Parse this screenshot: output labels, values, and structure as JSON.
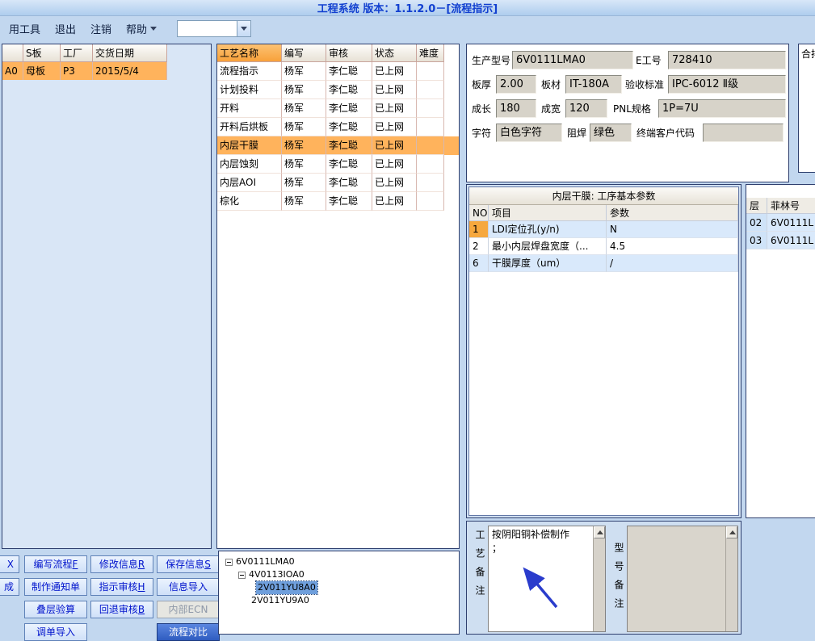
{
  "window": {
    "title": "工程系统 版本：1.1.2.0－[流程指示]"
  },
  "menubar": {
    "items": [
      {
        "label": "用工具"
      },
      {
        "label": "退出"
      },
      {
        "label": "注销"
      },
      {
        "label": "帮助"
      }
    ],
    "combo_value": ""
  },
  "board_panel": {
    "headers": {
      "cut": "",
      "sboard": "S板",
      "factory": "工厂",
      "delivery": "交货日期"
    },
    "row": {
      "cut": "A0",
      "sboard": "母板",
      "factory": "P3",
      "delivery": "2015/5/4"
    }
  },
  "process_panel": {
    "headers": {
      "name": "工艺名称",
      "writer": "编写",
      "auditor": "审核",
      "status": "状态",
      "difficulty": "难度"
    },
    "rows": [
      {
        "name": "流程指示",
        "writer": "杨军",
        "auditor": "李仁聪",
        "status": "已上网",
        "difficulty": ""
      },
      {
        "name": "计划投料",
        "writer": "杨军",
        "auditor": "李仁聪",
        "status": "已上网",
        "difficulty": ""
      },
      {
        "name": "开料",
        "writer": "杨军",
        "auditor": "李仁聪",
        "status": "已上网",
        "difficulty": ""
      },
      {
        "name": "开料后烘板",
        "writer": "杨军",
        "auditor": "李仁聪",
        "status": "已上网",
        "difficulty": ""
      },
      {
        "name": "内层干膜",
        "writer": "杨军",
        "auditor": "李仁聪",
        "status": "已上网",
        "difficulty": ""
      },
      {
        "name": "内层蚀刻",
        "writer": "杨军",
        "auditor": "李仁聪",
        "status": "已上网",
        "difficulty": ""
      },
      {
        "name": "内层AOI",
        "writer": "杨军",
        "auditor": "李仁聪",
        "status": "已上网",
        "difficulty": ""
      },
      {
        "name": "棕化",
        "writer": "杨军",
        "auditor": "李仁聪",
        "status": "已上网",
        "difficulty": ""
      }
    ]
  },
  "info_panel": {
    "fields": {
      "model": {
        "label": "生产型号",
        "value": "6V0111LMA0"
      },
      "eno": {
        "label": "E工号",
        "value": "728410"
      },
      "thickness": {
        "label": "板厚",
        "value": "2.00"
      },
      "material": {
        "label": "板材",
        "value": "IT-180A"
      },
      "standard": {
        "label": "验收标准",
        "value": "IPC-6012 Ⅱ级"
      },
      "length": {
        "label": "成长",
        "value": "180"
      },
      "width": {
        "label": "成宽",
        "value": "120"
      },
      "pnl": {
        "label": "PNL规格",
        "value": "1P=7U"
      },
      "silkscreen": {
        "label": "字符",
        "value": "白色字符"
      },
      "soldermask": {
        "label": "阻焊",
        "value": "绿色"
      },
      "client": {
        "label": "终端客户代码",
        "value": ""
      }
    }
  },
  "hepai_panel": {
    "label": "合排"
  },
  "param_panel": {
    "title": "内层干膜: 工序基本参数",
    "headers": {
      "no": "NO",
      "item": "项目",
      "value": "参数"
    },
    "rows": [
      {
        "no": "1",
        "item": "LDI定位孔(y/n)",
        "value": "N"
      },
      {
        "no": "2",
        "item": "最小内层焊盘宽度（...",
        "value": "4.5"
      },
      {
        "no": "6",
        "item": "干膜厚度（um）",
        "value": "/"
      }
    ]
  },
  "film_panel": {
    "headers": {
      "layer": "层",
      "film": "菲林号"
    },
    "rows": [
      {
        "layer": "02",
        "film": "6V0111L"
      },
      {
        "layer": "03",
        "film": "6V0111L"
      }
    ]
  },
  "actions": {
    "buttons": [
      {
        "text": "X",
        "key": ""
      },
      {
        "text": "编写流程",
        "key": "F"
      },
      {
        "text": "修改信息",
        "key": "R"
      },
      {
        "text": "保存信息",
        "key": "S"
      },
      {
        "text": "成",
        "key": ""
      },
      {
        "text": "制作通知单",
        "key": ""
      },
      {
        "text": "指示审核",
        "key": "H"
      },
      {
        "text": "信息导入",
        "key": ""
      },
      {
        "text": "叠层验算",
        "key": ""
      },
      {
        "text": "回退审核",
        "key": "B"
      },
      {
        "text": "内部ECN",
        "key": ""
      },
      {
        "text": "调单导入",
        "key": ""
      },
      {
        "text": "流程对比",
        "key": ""
      }
    ]
  },
  "tree_panel": {
    "nodes": [
      {
        "label": "6V0111LMA0"
      },
      {
        "label": "4V0113IOA0"
      },
      {
        "label": "2V011YU8A0"
      },
      {
        "label": "2V011YU9A0"
      }
    ]
  },
  "remarks": {
    "process": {
      "label": "工艺备注",
      "text": "按阴阳铜补偿制作\n；"
    },
    "model": {
      "label": "型号备注",
      "text": ""
    }
  }
}
